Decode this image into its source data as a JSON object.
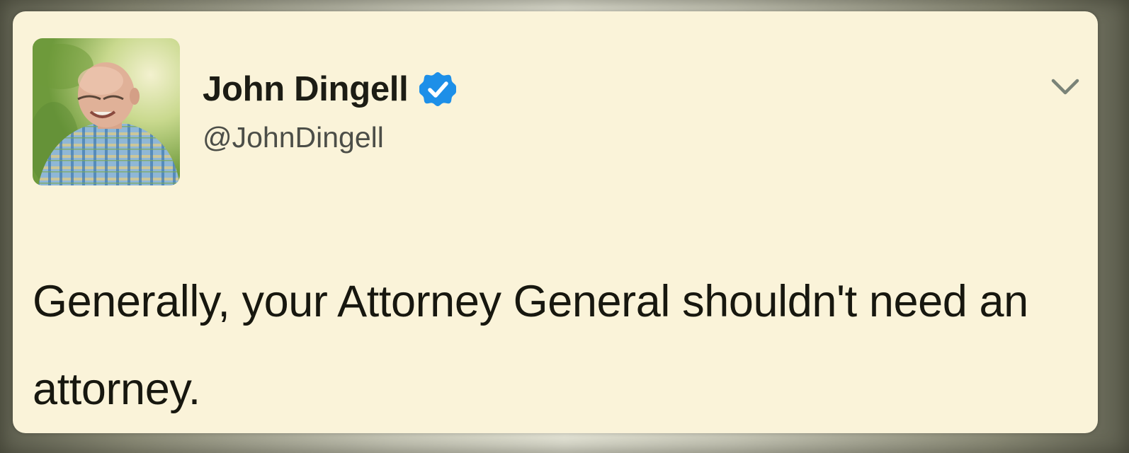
{
  "tweet": {
    "author": {
      "display_name": "John Dingell",
      "handle": "@JohnDingell",
      "verified": true
    },
    "text": "Generally, your Attorney General shouldn't need an attorney.",
    "menu_icon": "chevron-down-icon"
  },
  "colors": {
    "card_background": "#faf3d9",
    "text": "#17170f",
    "handle_text": "#4c4e48",
    "verified_blue": "#1d8fe8",
    "chevron": "#7a8378"
  }
}
